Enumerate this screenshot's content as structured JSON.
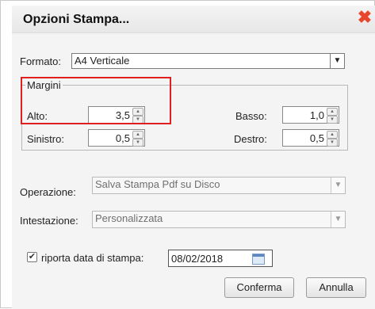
{
  "dialog": {
    "title": "Opzioni Stampa..."
  },
  "formato": {
    "label": "Formato:",
    "value": "A4 Verticale"
  },
  "margini": {
    "legend": "Margini",
    "alto": {
      "label": "Alto:",
      "value": "3,5"
    },
    "basso": {
      "label": "Basso:",
      "value": "1,0"
    },
    "sinistro": {
      "label": "Sinistro:",
      "value": "0,5"
    },
    "destro": {
      "label": "Destro:",
      "value": "0,5"
    }
  },
  "operazione": {
    "label": "Operazione:",
    "value": "Salva Stampa Pdf su Disco"
  },
  "intestazione": {
    "label": "Intestazione:",
    "value": "Personalizzata"
  },
  "data_stampa": {
    "label": "riporta data di stampa:",
    "checked": true,
    "value": "08/02/2018"
  },
  "buttons": {
    "confirm": "Conferma",
    "cancel": "Annulla"
  },
  "colors": {
    "highlight": "#e02020",
    "close_icon": "#e8472d"
  },
  "icons": [
    "close-icon",
    "chevron-down-icon",
    "spinner-icon",
    "calendar-icon",
    "checkmark-icon"
  ]
}
